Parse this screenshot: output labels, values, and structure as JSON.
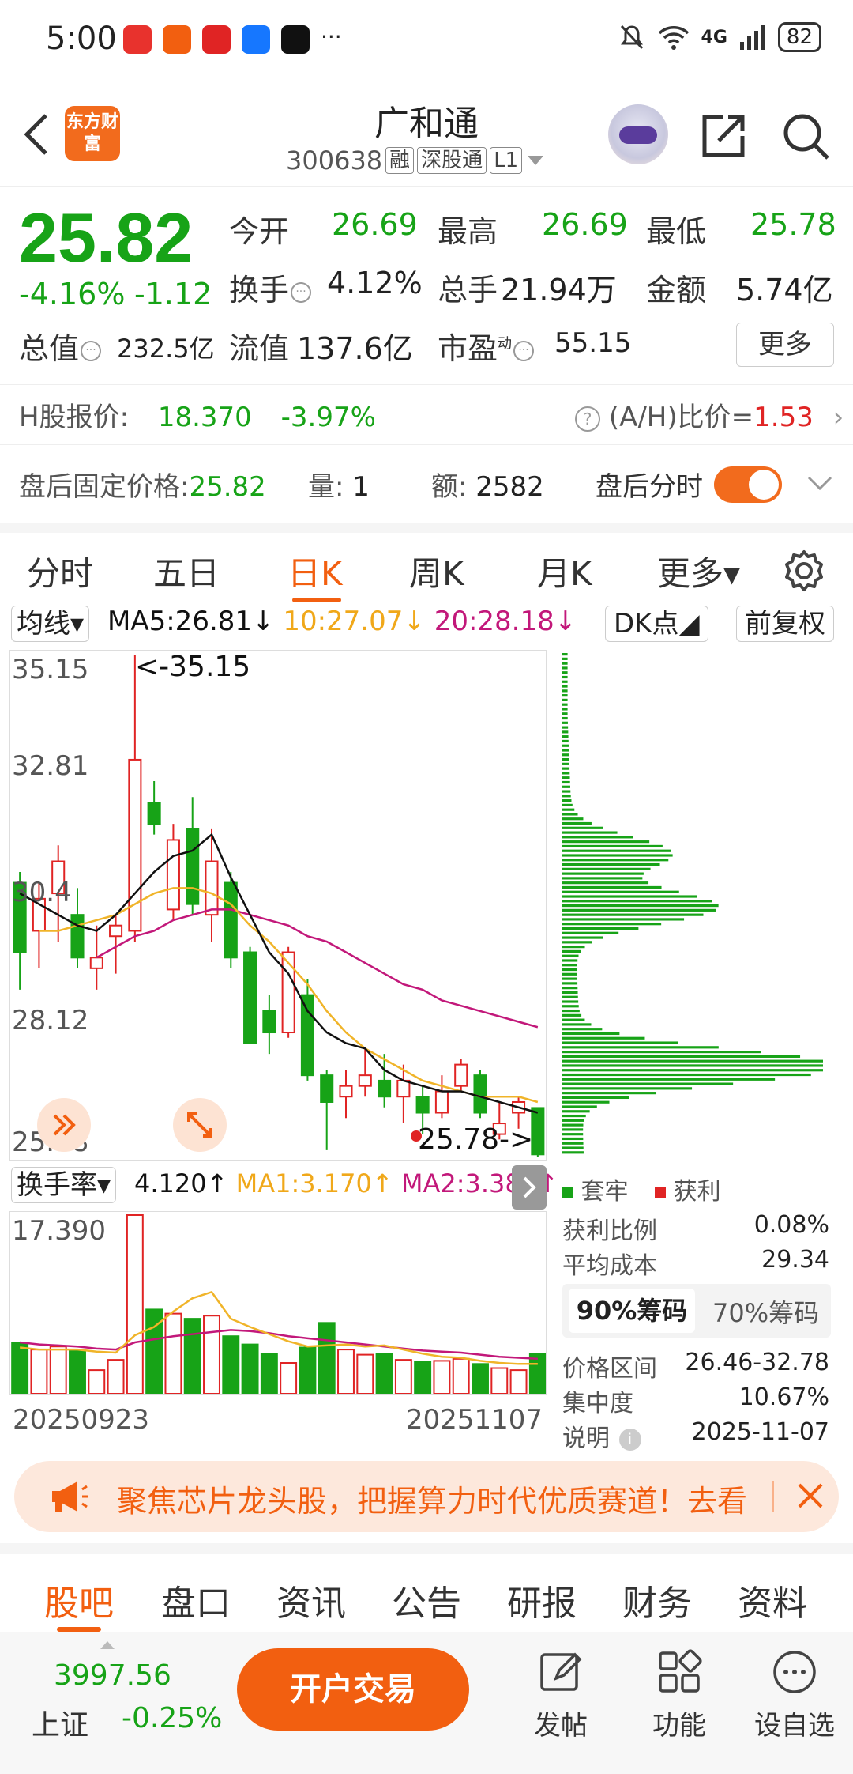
{
  "status_bar": {
    "time": "5:00",
    "more": "···",
    "network": "4G",
    "battery": "82",
    "app_icon_colors": [
      "#e8322d",
      "#f25f10",
      "#e02424",
      "#1677ff",
      "#111111"
    ]
  },
  "header": {
    "stock_name": "广和通",
    "stock_code": "300638",
    "tags": [
      "融",
      "深股通",
      "L1"
    ],
    "logo_text": "东方财富"
  },
  "quote": {
    "price": "25.82",
    "change_pct": "-4.16%",
    "change": "-1.12",
    "open_label": "今开",
    "open": "26.69",
    "high_label": "最高",
    "high": "26.69",
    "low_label": "最低",
    "low": "25.78",
    "turnover_label": "换手",
    "turnover": "4.12%",
    "volume_label": "总手",
    "volume": "21.94万",
    "amount_label": "金额",
    "amount": "5.74亿",
    "mktcap_label": "总值",
    "mktcap": "232.5亿",
    "float_label": "流值",
    "float": "137.6亿",
    "pe_label": "市盈",
    "pe_sup": "动",
    "pe": "55.15",
    "more_label": "更多"
  },
  "hshare": {
    "label": "H股报价:",
    "price": "18.370",
    "change_pct": "-3.97%",
    "ah_label": "(A/H)比价=",
    "ah_value": "1.53"
  },
  "afterhours": {
    "fixed_label": "盘后固定价格:",
    "fixed_price": "25.82",
    "qty_label": "量:",
    "qty": "1",
    "amt_label": "额:",
    "amt": "2582",
    "toggle_label": "盘后分时"
  },
  "tabs": [
    "分时",
    "五日",
    "日K",
    "周K",
    "月K",
    "更多▾"
  ],
  "ma_row": {
    "selector": "均线▾",
    "ma5": "MA5:26.81↓",
    "ma10": "10:27.07↓",
    "ma20": "20:28.18↓",
    "dk_button": "DK点◢",
    "adjust_button": "前复权"
  },
  "kline_labels": {
    "y_top": "35.15",
    "y_2": "32.81",
    "y_3": "30.4",
    "y_4": "28.12",
    "y_bottom": "25.78",
    "max_note": "<-35.15",
    "min_note": "25.78->"
  },
  "volume_row": {
    "selector": "换手率▾",
    "value": "4.120↑",
    "ma1": "MA1:3.170↑",
    "ma2": "MA2:3.380↑",
    "y_top": "17.390",
    "date_start": "20250923",
    "date_end": "20251107"
  },
  "chip": {
    "legend_trapped": "套牢",
    "legend_profit": "获利",
    "profit_ratio_label": "获利比例",
    "profit_ratio": "0.08%",
    "avg_cost_label": "平均成本",
    "avg_cost": "29.34",
    "tab_90": "90%筹码",
    "tab_70": "70%筹码",
    "range_label": "价格区间",
    "range": "26.46-32.78",
    "concentration_label": "集中度",
    "concentration": "10.67%",
    "note_label": "说明",
    "note_date": "2025-11-07"
  },
  "banner": {
    "text": "聚焦芯片龙头股，把握算力时代优质赛道！去看"
  },
  "bottom_tabs": [
    "股吧",
    "盘口",
    "资讯",
    "公告",
    "研报",
    "财务",
    "资料"
  ],
  "footer": {
    "index_value": "3997.56",
    "index_name": "上证",
    "index_change": "-0.25%",
    "trade_button": "开户交易",
    "post": "发帖",
    "functions": "功能",
    "watchlist": "设自选"
  },
  "colors": {
    "accent": "#f25f10",
    "down_green": "#17a317",
    "up_red": "#e02424",
    "ma5": "#111111",
    "ma10": "#f0b429",
    "ma20": "#c2187a"
  },
  "chart_data": {
    "type": "candlestick",
    "ylim": [
      25.78,
      35.15
    ],
    "candles": [
      {
        "o": 30.9,
        "c": 29.6,
        "h": 31.1,
        "l": 28.9
      },
      {
        "o": 30.0,
        "c": 30.6,
        "h": 30.9,
        "l": 29.3
      },
      {
        "o": 30.7,
        "c": 31.3,
        "h": 31.6,
        "l": 29.8
      },
      {
        "o": 30.3,
        "c": 29.5,
        "h": 30.8,
        "l": 29.3
      },
      {
        "o": 29.3,
        "c": 29.5,
        "h": 30.1,
        "l": 28.9
      },
      {
        "o": 29.9,
        "c": 30.1,
        "h": 30.3,
        "l": 29.2
      },
      {
        "o": 30.0,
        "c": 33.2,
        "h": 35.15,
        "l": 29.8
      },
      {
        "o": 32.4,
        "c": 32.0,
        "h": 32.8,
        "l": 31.8
      },
      {
        "o": 30.4,
        "c": 31.7,
        "h": 32.0,
        "l": 30.2
      },
      {
        "o": 31.9,
        "c": 30.5,
        "h": 32.5,
        "l": 30.3
      },
      {
        "o": 30.3,
        "c": 31.3,
        "h": 31.9,
        "l": 29.8
      },
      {
        "o": 30.9,
        "c": 29.5,
        "h": 31.1,
        "l": 29.3
      },
      {
        "o": 29.6,
        "c": 27.9,
        "h": 29.7,
        "l": 27.9
      },
      {
        "o": 28.5,
        "c": 28.1,
        "h": 28.8,
        "l": 27.7
      },
      {
        "o": 28.1,
        "c": 29.6,
        "h": 29.7,
        "l": 28.0
      },
      {
        "o": 28.8,
        "c": 27.3,
        "h": 29.1,
        "l": 27.2
      },
      {
        "o": 27.3,
        "c": 26.8,
        "h": 27.4,
        "l": 25.9
      },
      {
        "o": 26.9,
        "c": 27.1,
        "h": 27.4,
        "l": 26.5
      },
      {
        "o": 27.1,
        "c": 27.3,
        "h": 27.8,
        "l": 26.9
      },
      {
        "o": 27.2,
        "c": 26.9,
        "h": 27.7,
        "l": 26.7
      },
      {
        "o": 26.9,
        "c": 27.2,
        "h": 27.5,
        "l": 26.4
      },
      {
        "o": 26.9,
        "c": 26.6,
        "h": 27.1,
        "l": 26.2
      },
      {
        "o": 26.6,
        "c": 27.0,
        "h": 27.3,
        "l": 26.5
      },
      {
        "o": 27.1,
        "c": 27.5,
        "h": 27.6,
        "l": 27.0
      },
      {
        "o": 27.3,
        "c": 26.6,
        "h": 27.4,
        "l": 26.5
      },
      {
        "o": 26.2,
        "c": 26.4,
        "h": 26.8,
        "l": 26.1
      },
      {
        "o": 26.6,
        "c": 26.8,
        "h": 26.9,
        "l": 26.3
      },
      {
        "o": 26.69,
        "c": 25.82,
        "h": 26.69,
        "l": 25.78
      }
    ],
    "ma5": [
      30.7,
      30.5,
      30.3,
      30.1,
      30.0,
      30.3,
      30.7,
      31.1,
      31.4,
      31.5,
      31.8,
      31.0,
      30.3,
      29.6,
      29.2,
      28.5,
      28.1,
      27.9,
      27.8,
      27.4,
      27.2,
      27.1,
      27.0,
      27.0,
      26.9,
      26.8,
      26.7,
      26.6
    ],
    "ma10": [
      null,
      30.0,
      30.0,
      30.1,
      30.2,
      30.3,
      30.5,
      30.7,
      30.8,
      30.8,
      30.7,
      30.5,
      30.1,
      29.8,
      29.4,
      29.0,
      28.5,
      28.1,
      27.8,
      27.6,
      27.4,
      27.2,
      27.1,
      27.0,
      26.9,
      26.9,
      26.9,
      26.8
    ],
    "ma20": [
      null,
      null,
      null,
      null,
      29.5,
      29.7,
      29.9,
      30.0,
      30.2,
      30.3,
      30.4,
      30.4,
      30.3,
      30.2,
      30.1,
      29.9,
      29.8,
      29.6,
      29.4,
      29.2,
      29.0,
      28.9,
      28.7,
      28.6,
      28.5,
      28.4,
      28.3,
      28.2
    ],
    "turnover_ylim": [
      0,
      17.39
    ],
    "turnover": [
      5.0,
      4.3,
      4.6,
      4.3,
      2.3,
      3.3,
      17.39,
      8.2,
      7.8,
      7.3,
      7.6,
      5.6,
      4.8,
      3.9,
      3.0,
      4.5,
      6.9,
      4.3,
      3.8,
      3.9,
      3.3,
      3.1,
      3.2,
      3.4,
      2.9,
      2.5,
      2.3,
      3.9
    ],
    "turnover_ma1": [
      4.5,
      4.3,
      4.3,
      4.3,
      4.1,
      4.0,
      5.7,
      6.5,
      8.0,
      9.3,
      9.9,
      7.3,
      6.5,
      5.8,
      5.1,
      4.6,
      4.7,
      4.8,
      4.6,
      4.7,
      4.3,
      3.9,
      3.6,
      3.5,
      3.2,
      3.0,
      2.9,
      2.9
    ],
    "turnover_ma2": [
      5.0,
      4.8,
      4.7,
      4.6,
      4.4,
      4.3,
      5.0,
      5.3,
      5.6,
      5.8,
      6.0,
      6.2,
      6.1,
      5.9,
      5.6,
      5.4,
      5.2,
      5.0,
      4.8,
      4.6,
      4.4,
      4.2,
      4.1,
      4.0,
      3.8,
      3.6,
      3.5,
      3.4
    ],
    "chip_distribution": {
      "price_range": [
        25.78,
        35.15
      ],
      "levels": 110,
      "peaks": [
        {
          "price": 27.4,
          "weight": 1.0
        },
        {
          "price": 30.4,
          "weight": 0.55
        },
        {
          "price": 31.4,
          "weight": 0.38
        }
      ]
    }
  }
}
